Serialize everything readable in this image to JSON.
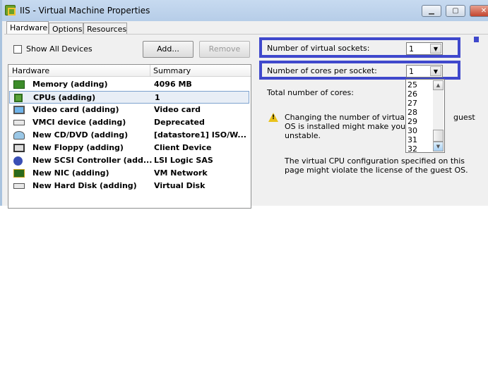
{
  "window": {
    "title": "IIS - Virtual Machine Properties",
    "minimize": "▁",
    "maximize": "▢",
    "close": "✕"
  },
  "tabs": [
    {
      "label": "Hardware",
      "active": true
    },
    {
      "label": "Options"
    },
    {
      "label": "Resources"
    }
  ],
  "toolbar": {
    "show_all_devices": "Show All Devices",
    "show_all_checked": false,
    "add": "Add...",
    "remove": "Remove"
  },
  "hardware_list": {
    "columns": [
      "Hardware",
      "Summary"
    ],
    "rows": [
      {
        "name": "Memory (adding)",
        "summary": "4096 MB",
        "icon": "memory-icon"
      },
      {
        "name": "CPUs (adding)",
        "summary": "1",
        "icon": "cpu-icon",
        "selected": true
      },
      {
        "name": "Video card  (adding)",
        "summary": "Video card",
        "icon": "monitor-icon"
      },
      {
        "name": "VMCI device (adding)",
        "summary": "Deprecated",
        "icon": "device-icon"
      },
      {
        "name": "New CD/DVD (adding)",
        "summary": "[datastore1] ISO/W...",
        "icon": "cd-dvd-icon"
      },
      {
        "name": "New Floppy (adding)",
        "summary": "Client Device",
        "icon": "floppy-icon"
      },
      {
        "name": "New SCSI Controller (add...",
        "summary": "LSI Logic SAS",
        "icon": "scsi-icon"
      },
      {
        "name": "New NIC (adding)",
        "summary": "VM Network",
        "icon": "nic-icon"
      },
      {
        "name": "New Hard Disk (adding)",
        "summary": "Virtual Disk",
        "icon": "hard-disk-icon"
      }
    ]
  },
  "cpu": {
    "sockets_label": "Number of virtual sockets:",
    "sockets_value": "1",
    "cores_label": "Number of cores per socket:",
    "cores_value": "1",
    "total_label": "Total number of cores:",
    "dropdown_options": [
      "25",
      "26",
      "27",
      "28",
      "29",
      "30",
      "31",
      "32"
    ],
    "warning": "Changing the number of virtual CPU        guest OS is installed might make your virtu unstable.",
    "warning_line1": "Changing the number of virtual CPU",
    "warning_line1b": "guest",
    "warning_line2": "OS is installed might make your virtu",
    "warning_line3": "unstable.",
    "license_note": "The virtual CPU configuration specified on this page might violate the license of the guest OS."
  },
  "colors": {
    "highlight": "#3f48cc"
  }
}
